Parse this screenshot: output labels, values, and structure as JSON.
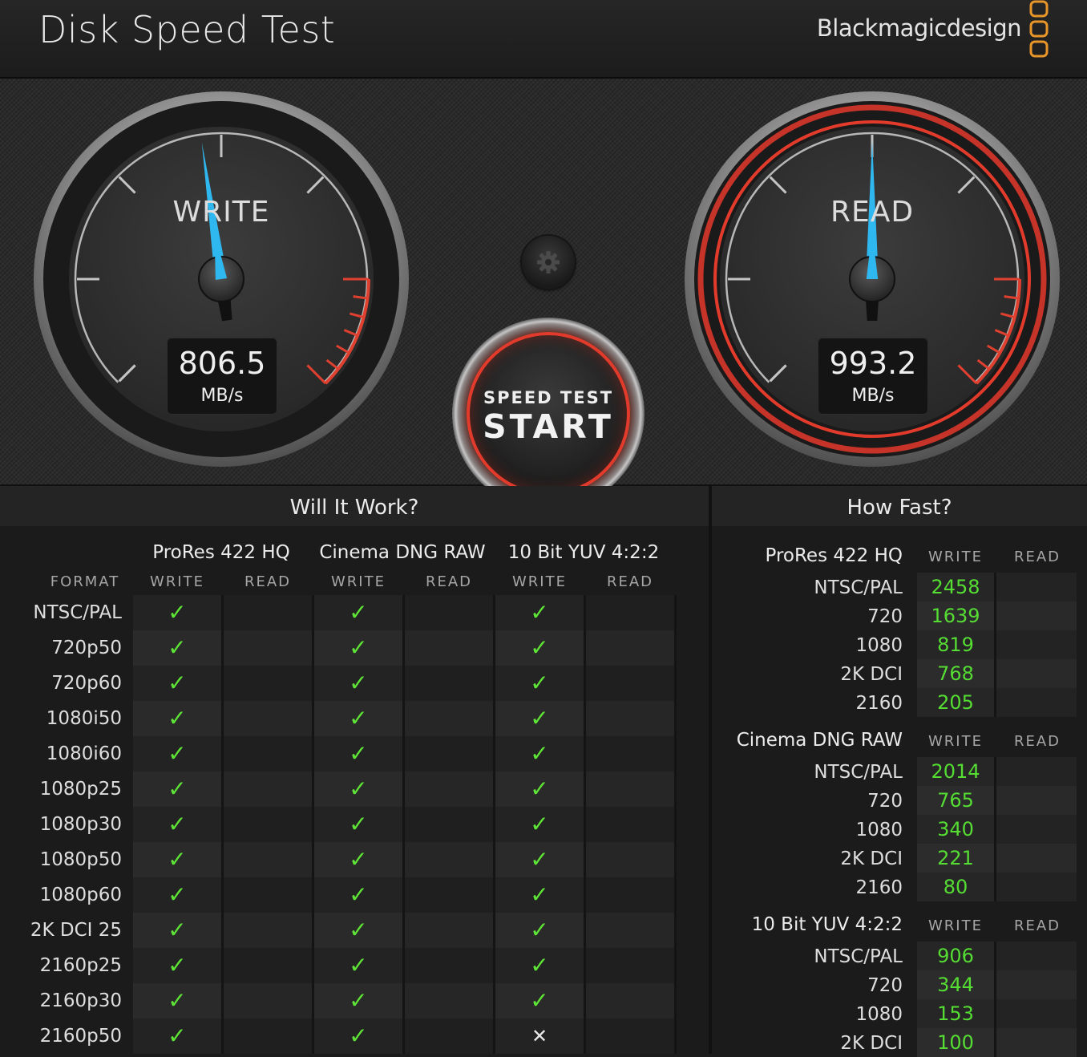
{
  "app": {
    "title": "Disk Speed Test",
    "brand": "Blackmagicdesign"
  },
  "gauges": {
    "write": {
      "label": "WRITE",
      "value": "806.5",
      "unit": "MB/s",
      "level": 0.47
    },
    "read": {
      "label": "READ",
      "value": "993.2",
      "unit": "MB/s",
      "level": 0.5
    }
  },
  "start_button": {
    "small": "SPEED TEST",
    "big": "START"
  },
  "settings_icon": "gear-icon",
  "colors": {
    "accent_red": "#e23b2b",
    "needle_blue": "#2fb8f0",
    "check_green": "#5ee536",
    "value_green": "#55dd33"
  },
  "will_it_work": {
    "title": "Will It Work?",
    "format_header": "FORMAT",
    "codecs": [
      {
        "name": "ProRes 422 HQ",
        "write": "WRITE",
        "read": "READ"
      },
      {
        "name": "Cinema DNG RAW",
        "write": "WRITE",
        "read": "READ"
      },
      {
        "name": "10 Bit YUV 4:2:2",
        "write": "WRITE",
        "read": "READ"
      }
    ],
    "rows": [
      {
        "format": "NTSC/PAL",
        "results": [
          "check",
          "",
          "check",
          "",
          "check",
          ""
        ]
      },
      {
        "format": "720p50",
        "results": [
          "check",
          "",
          "check",
          "",
          "check",
          ""
        ]
      },
      {
        "format": "720p60",
        "results": [
          "check",
          "",
          "check",
          "",
          "check",
          ""
        ]
      },
      {
        "format": "1080i50",
        "results": [
          "check",
          "",
          "check",
          "",
          "check",
          ""
        ]
      },
      {
        "format": "1080i60",
        "results": [
          "check",
          "",
          "check",
          "",
          "check",
          ""
        ]
      },
      {
        "format": "1080p25",
        "results": [
          "check",
          "",
          "check",
          "",
          "check",
          ""
        ]
      },
      {
        "format": "1080p30",
        "results": [
          "check",
          "",
          "check",
          "",
          "check",
          ""
        ]
      },
      {
        "format": "1080p50",
        "results": [
          "check",
          "",
          "check",
          "",
          "check",
          ""
        ]
      },
      {
        "format": "1080p60",
        "results": [
          "check",
          "",
          "check",
          "",
          "check",
          ""
        ]
      },
      {
        "format": "2K DCI 25",
        "results": [
          "check",
          "",
          "check",
          "",
          "check",
          ""
        ]
      },
      {
        "format": "2160p25",
        "results": [
          "check",
          "",
          "check",
          "",
          "check",
          ""
        ]
      },
      {
        "format": "2160p30",
        "results": [
          "check",
          "",
          "check",
          "",
          "check",
          ""
        ]
      },
      {
        "format": "2160p50",
        "results": [
          "check",
          "",
          "check",
          "",
          "cross",
          ""
        ]
      }
    ]
  },
  "how_fast": {
    "title": "How Fast?",
    "groups": [
      {
        "codec": "ProRes 422 HQ",
        "write": "WRITE",
        "read": "READ",
        "rows": [
          {
            "label": "NTSC/PAL",
            "write": "2458"
          },
          {
            "label": "720",
            "write": "1639"
          },
          {
            "label": "1080",
            "write": "819"
          },
          {
            "label": "2K DCI",
            "write": "768"
          },
          {
            "label": "2160",
            "write": "205"
          }
        ]
      },
      {
        "codec": "Cinema DNG RAW",
        "write": "WRITE",
        "read": "READ",
        "rows": [
          {
            "label": "NTSC/PAL",
            "write": "2014"
          },
          {
            "label": "720",
            "write": "765"
          },
          {
            "label": "1080",
            "write": "340"
          },
          {
            "label": "2K DCI",
            "write": "221"
          },
          {
            "label": "2160",
            "write": "80"
          }
        ]
      },
      {
        "codec": "10 Bit YUV 4:2:2",
        "write": "WRITE",
        "read": "READ",
        "rows": [
          {
            "label": "NTSC/PAL",
            "write": "906"
          },
          {
            "label": "720",
            "write": "344"
          },
          {
            "label": "1080",
            "write": "153"
          },
          {
            "label": "2K DCI",
            "write": "100"
          }
        ]
      }
    ]
  }
}
